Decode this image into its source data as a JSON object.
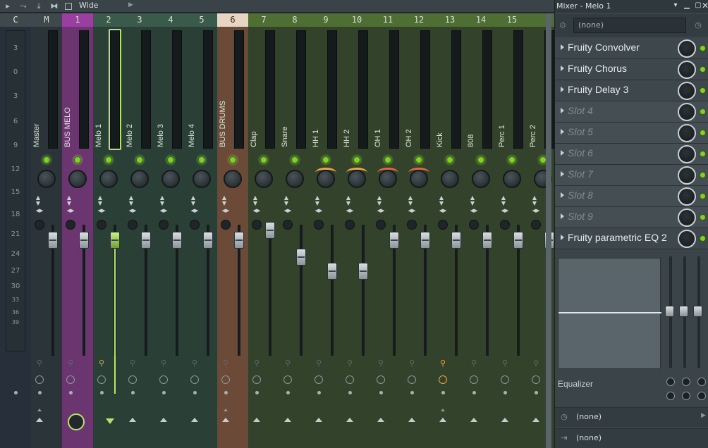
{
  "toolbar": {
    "view_label": "Wide"
  },
  "ruler": {
    "marks": [
      "3",
      "0",
      "3",
      "6",
      "9",
      "12",
      "15",
      "18",
      "21",
      "24",
      "27",
      "30",
      "33",
      "36",
      "39"
    ]
  },
  "tracks": [
    {
      "head": "C",
      "name": "",
      "head_color": "#3e484d",
      "bg": "#27303a"
    },
    {
      "head": "M",
      "name": "Master",
      "head_color": "#3e484d",
      "bg": "#2b3438"
    },
    {
      "head": "1",
      "name": "BUS MELO",
      "head_color": "#9a3fa0",
      "bg": "#6b3570"
    },
    {
      "head": "2",
      "name": "Melo 1",
      "head_color": "#3a5a4c",
      "bg": "#2a3f36"
    },
    {
      "head": "3",
      "name": "Melo 2",
      "head_color": "#3a5a4c",
      "bg": "#2a3f36"
    },
    {
      "head": "4",
      "name": "Melo 3",
      "head_color": "#3a5a4c",
      "bg": "#2a3f36"
    },
    {
      "head": "5",
      "name": "Melo 4",
      "head_color": "#3a5a4c",
      "bg": "#2a3f36"
    },
    {
      "head": "6",
      "name": "BUS DRUMS",
      "head_color": "#e8d4c2",
      "bg": "#6b4a38"
    },
    {
      "head": "7",
      "name": "Clap",
      "head_color": "#4e6e33",
      "bg": "#33422a"
    },
    {
      "head": "8",
      "name": "Snare",
      "head_color": "#4e6e33",
      "bg": "#33422a"
    },
    {
      "head": "9",
      "name": "HH 1",
      "head_color": "#4e6e33",
      "bg": "#33422a"
    },
    {
      "head": "10",
      "name": "HH 2",
      "head_color": "#4e6e33",
      "bg": "#33422a"
    },
    {
      "head": "11",
      "name": "OH 1",
      "head_color": "#4e6e33",
      "bg": "#33422a"
    },
    {
      "head": "12",
      "name": "OH 2",
      "head_color": "#4e6e33",
      "bg": "#33422a"
    },
    {
      "head": "13",
      "name": "Kick",
      "head_color": "#4e6e33",
      "bg": "#33422a"
    },
    {
      "head": "14",
      "name": "808",
      "head_color": "#4e6e33",
      "bg": "#33422a"
    },
    {
      "head": "15",
      "name": "Perc 1",
      "head_color": "#4e6e33",
      "bg": "#33422a"
    },
    {
      "head": "",
      "name": "Perc 2",
      "head_color": "#4e6e33",
      "bg": "#33422a"
    }
  ],
  "panel": {
    "title": "Mixer - Melo 1",
    "input_value": "(none)",
    "slots": [
      {
        "label": "Fruity Convolver",
        "empty": false
      },
      {
        "label": "Fruity Chorus",
        "empty": false
      },
      {
        "label": "Fruity Delay 3",
        "empty": false
      },
      {
        "label": "Slot 4",
        "empty": true
      },
      {
        "label": "Slot 5",
        "empty": true
      },
      {
        "label": "Slot 6",
        "empty": true
      },
      {
        "label": "Slot 7",
        "empty": true
      },
      {
        "label": "Slot 8",
        "empty": true
      },
      {
        "label": "Slot 9",
        "empty": true
      },
      {
        "label": "Fruity parametric EQ 2",
        "empty": false
      }
    ],
    "eq_label": "Equalizer",
    "row1": "(none)",
    "row2": "(none)"
  }
}
